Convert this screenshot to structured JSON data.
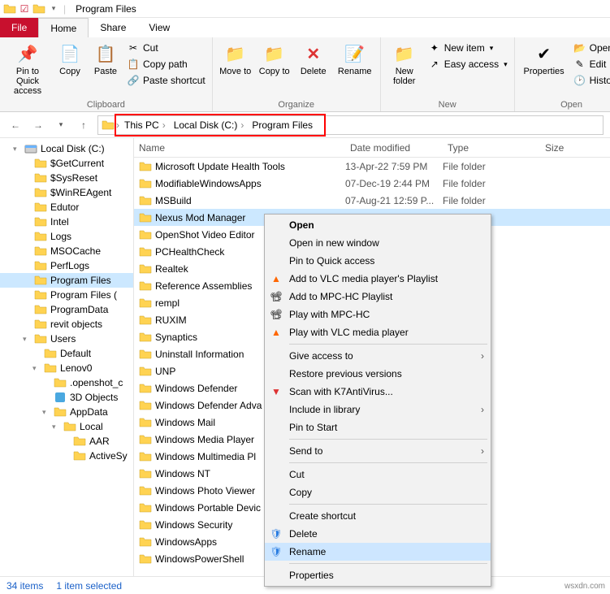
{
  "title": "Program Files",
  "tabs": {
    "file": "File",
    "home": "Home",
    "share": "Share",
    "view": "View"
  },
  "ribbon": {
    "clipboard": {
      "pin": "Pin to Quick access",
      "copy": "Copy",
      "paste": "Paste",
      "cut": "Cut",
      "copypath": "Copy path",
      "pasteshortcut": "Paste shortcut",
      "label": "Clipboard"
    },
    "organize": {
      "move": "Move to",
      "copyto": "Copy to",
      "delete": "Delete",
      "rename": "Rename",
      "label": "Organize"
    },
    "new": {
      "folder": "New folder",
      "item": "New item",
      "easy": "Easy access",
      "label": "New"
    },
    "open": {
      "props": "Properties",
      "open": "Open",
      "edit": "Edit",
      "history": "History",
      "label": "Open"
    }
  },
  "breadcrumb": [
    "This PC",
    "Local Disk (C:)",
    "Program Files"
  ],
  "headers": {
    "name": "Name",
    "date": "Date modified",
    "type": "Type",
    "size": "Size"
  },
  "tree": [
    {
      "l": 1,
      "exp": "▾",
      "icon": "disk",
      "label": "Local Disk (C:)"
    },
    {
      "l": 2,
      "icon": "fld",
      "label": "$GetCurrent"
    },
    {
      "l": 2,
      "icon": "fld",
      "label": "$SysReset"
    },
    {
      "l": 2,
      "icon": "fld",
      "label": "$WinREAgent"
    },
    {
      "l": 2,
      "icon": "fld",
      "label": "Edutor"
    },
    {
      "l": 2,
      "icon": "fld",
      "label": "Intel"
    },
    {
      "l": 2,
      "icon": "fld",
      "label": "Logs"
    },
    {
      "l": 2,
      "icon": "fld",
      "label": "MSOCache"
    },
    {
      "l": 2,
      "icon": "fld",
      "label": "PerfLogs"
    },
    {
      "l": 2,
      "icon": "fld",
      "label": "Program Files",
      "sel": true
    },
    {
      "l": 2,
      "icon": "fld",
      "label": "Program Files ("
    },
    {
      "l": 2,
      "icon": "fld",
      "label": "ProgramData"
    },
    {
      "l": 2,
      "icon": "fld",
      "label": "revit objects"
    },
    {
      "l": 2,
      "exp": "▾",
      "icon": "fld",
      "label": "Users"
    },
    {
      "l": 3,
      "icon": "fld",
      "label": "Default"
    },
    {
      "l": 3,
      "exp": "▾",
      "icon": "fld",
      "label": "Lenov0"
    },
    {
      "l": 4,
      "icon": "fld",
      "label": ".openshot_c"
    },
    {
      "l": 4,
      "icon": "3d",
      "label": "3D Objects"
    },
    {
      "l": 4,
      "exp": "▾",
      "icon": "fld",
      "label": "AppData"
    },
    {
      "l": 5,
      "exp": "▾",
      "icon": "fld",
      "label": "Local"
    },
    {
      "l": 6,
      "icon": "fld",
      "label": "AAR"
    },
    {
      "l": 6,
      "icon": "fld",
      "label": "ActiveSy"
    }
  ],
  "files": [
    {
      "name": "Microsoft Update Health Tools",
      "date": "13-Apr-22 7:59 PM",
      "type": "File folder"
    },
    {
      "name": "ModifiableWindowsApps",
      "date": "07-Dec-19 2:44 PM",
      "type": "File folder"
    },
    {
      "name": "MSBuild",
      "date": "07-Aug-21 12:59 P...",
      "type": "File folder"
    },
    {
      "name": "Nexus Mod Manager",
      "date": "",
      "type": "",
      "sel": true
    },
    {
      "name": "OpenShot Video Editor",
      "date": "",
      "type": ""
    },
    {
      "name": "PCHealthCheck",
      "date": "",
      "type": ""
    },
    {
      "name": "Realtek",
      "date": "",
      "type": ""
    },
    {
      "name": "Reference Assemblies",
      "date": "",
      "type": ""
    },
    {
      "name": "rempl",
      "date": "",
      "type": ""
    },
    {
      "name": "RUXIM",
      "date": "",
      "type": ""
    },
    {
      "name": "Synaptics",
      "date": "",
      "type": ""
    },
    {
      "name": "Uninstall Information",
      "date": "",
      "type": ""
    },
    {
      "name": "UNP",
      "date": "",
      "type": ""
    },
    {
      "name": "Windows Defender",
      "date": "",
      "type": ""
    },
    {
      "name": "Windows Defender Adva",
      "date": "",
      "type": ""
    },
    {
      "name": "Windows Mail",
      "date": "",
      "type": ""
    },
    {
      "name": "Windows Media Player",
      "date": "",
      "type": ""
    },
    {
      "name": "Windows Multimedia Pl",
      "date": "",
      "type": ""
    },
    {
      "name": "Windows NT",
      "date": "",
      "type": ""
    },
    {
      "name": "Windows Photo Viewer",
      "date": "",
      "type": ""
    },
    {
      "name": "Windows Portable Devic",
      "date": "",
      "type": ""
    },
    {
      "name": "Windows Security",
      "date": "",
      "type": ""
    },
    {
      "name": "WindowsApps",
      "date": "",
      "type": ""
    },
    {
      "name": "WindowsPowerShell",
      "date": "",
      "type": ""
    }
  ],
  "status": {
    "items": "34 items",
    "selected": "1 item selected"
  },
  "ctx": [
    {
      "label": "Open",
      "bold": true
    },
    {
      "label": "Open in new window"
    },
    {
      "label": "Pin to Quick access"
    },
    {
      "label": "Add to VLC media player's Playlist",
      "icon": "vlc"
    },
    {
      "label": "Add to MPC-HC Playlist",
      "icon": "mpc"
    },
    {
      "label": "Play with MPC-HC",
      "icon": "mpc"
    },
    {
      "label": "Play with VLC media player",
      "icon": "vlc"
    },
    {
      "sep": true
    },
    {
      "label": "Give access to",
      "sub": true
    },
    {
      "label": "Restore previous versions"
    },
    {
      "label": "Scan with K7AntiVirus...",
      "icon": "k7"
    },
    {
      "label": "Include in library",
      "sub": true
    },
    {
      "label": "Pin to Start"
    },
    {
      "sep": true
    },
    {
      "label": "Send to",
      "sub": true
    },
    {
      "sep": true
    },
    {
      "label": "Cut"
    },
    {
      "label": "Copy"
    },
    {
      "sep": true
    },
    {
      "label": "Create shortcut"
    },
    {
      "label": "Delete",
      "icon": "shield"
    },
    {
      "label": "Rename",
      "icon": "shield",
      "hover": true
    },
    {
      "sep": true
    },
    {
      "label": "Properties"
    }
  ],
  "watermark": "wsxdn.com"
}
